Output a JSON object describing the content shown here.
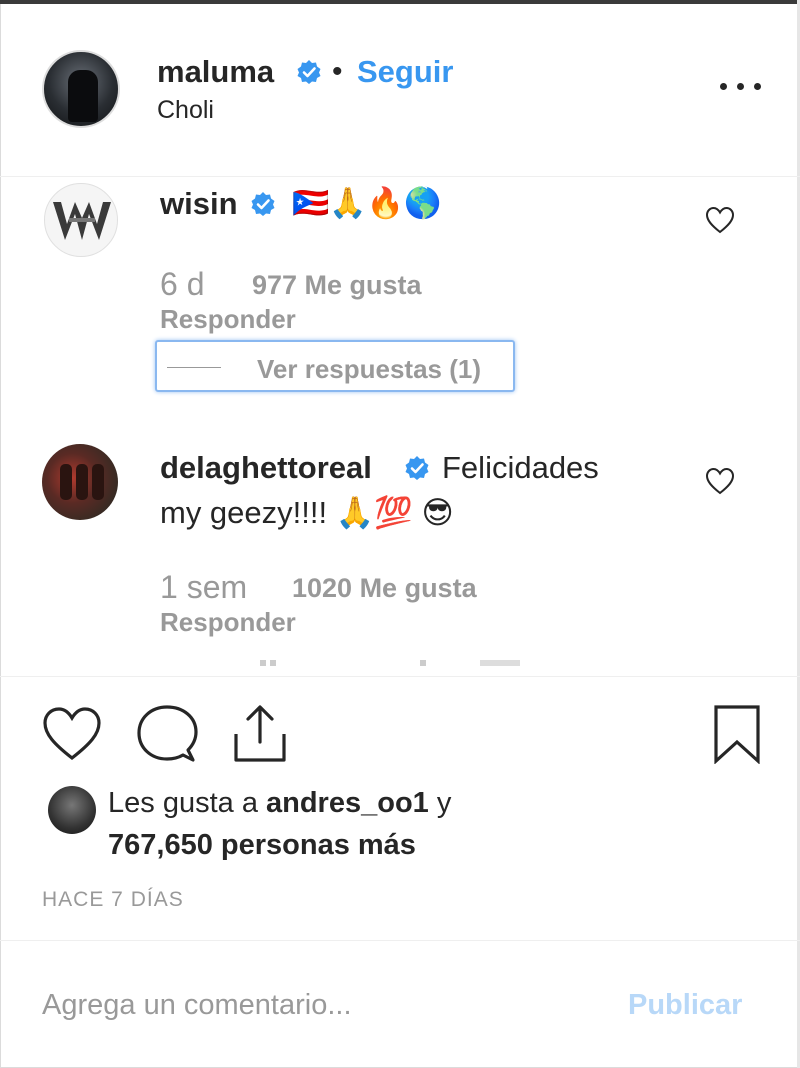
{
  "post": {
    "author": "maluma",
    "follow_label": "Seguir",
    "separator": "•",
    "location": "Choli"
  },
  "comments": [
    {
      "username": "wisin",
      "text": "🇵🇷🙏🔥🌎",
      "time": "6 d",
      "likes": "977 Me gusta",
      "reply_label": "Responder",
      "view_replies": "Ver respuestas (1)"
    },
    {
      "username": "delaghettoreal",
      "text_line1": "Felicidades",
      "text_line2": "my geezy!!!! 🙏💯 😎",
      "time": "1 sem",
      "likes": "1020 Me gusta",
      "reply_label": "Responder"
    }
  ],
  "likes": {
    "prefix": "Les gusta a ",
    "user": "andres_oo1",
    "conjunction": " y",
    "others": "767,650 personas más"
  },
  "timestamp": "HACE 7 DÍAS",
  "comment_input": {
    "placeholder": "Agrega un comentario...",
    "publish_label": "Publicar"
  },
  "icons": {
    "verified": "verified-badge-icon",
    "more": "more-options-icon",
    "heart": "heart-icon",
    "comment": "comment-icon",
    "share": "share-icon",
    "save": "bookmark-icon"
  },
  "colors": {
    "accent": "#3897f0",
    "text": "#262626",
    "muted": "#999999",
    "publish_disabled": "#b8d8f8"
  }
}
